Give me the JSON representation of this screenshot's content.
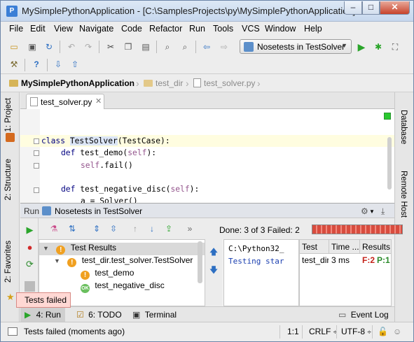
{
  "window": {
    "title": "MySimplePythonApplication - [C:\\SamplesProjects\\py\\MySimplePythonApplication]..."
  },
  "menu": [
    "File",
    "Edit",
    "View",
    "Navigate",
    "Code",
    "Refactor",
    "Run",
    "Tools",
    "VCS",
    "Window",
    "Help"
  ],
  "toolbar": {
    "run_config": "Nosetests in TestSolver"
  },
  "breadcrumbs": [
    "MySimplePythonApplication",
    "test_dir",
    "test_solver.py"
  ],
  "left_tabs": {
    "project": "1: Project",
    "structure": "2: Structure",
    "favorites": "2: Favorites"
  },
  "right_tabs": {
    "database": "Database",
    "remote_host": "Remote Host"
  },
  "editor": {
    "tab_label": "test_solver.py",
    "lines": {
      "l1_kw": "class ",
      "l1_name": "TestSolver",
      "l1_rest": "(TestCase):",
      "l2_kw": "def ",
      "l2_name": "test_demo(",
      "l2_self": "self",
      "l2_end": "):",
      "l3_self": "self",
      "l3_rest": ".fail()",
      "l4_kw": "def ",
      "l4_name": "test_negative_disc(",
      "l4_self": "self",
      "l4_end": "):",
      "l5": "a = Solver()"
    }
  },
  "run_panel": {
    "title": "Run",
    "config": "Nosetests in TestSolver",
    "status": "Done: 3 of 3  Failed: 2",
    "progress": 1.0,
    "tree": {
      "root": "Test Results",
      "suite": "test_dir.test_solver.TestSolver",
      "items": [
        "test_demo",
        "test_negative_disc"
      ]
    },
    "console": {
      "line1": "C:\\Python32_",
      "line2": "Testing star"
    },
    "stats": {
      "headers": [
        "Test",
        "Time ...",
        "Results"
      ],
      "row": {
        "test": "test_dir",
        "time": "3 ms",
        "failed": "F:2",
        "passed": "P:1"
      }
    }
  },
  "tool_window_bar": {
    "run": "4: Run",
    "todo": "6: TODO",
    "terminal": "Terminal",
    "event_log": "Event Log"
  },
  "tooltip": "Tests failed",
  "status_bar": {
    "message": "Tests failed (moments ago)",
    "position": "1:1",
    "line_sep": "CRLF",
    "encoding": "UTF-8"
  },
  "colors": {
    "fail": "#c4221a",
    "pass": "#2a8a2a",
    "progress_fail": "#d84c3e"
  }
}
